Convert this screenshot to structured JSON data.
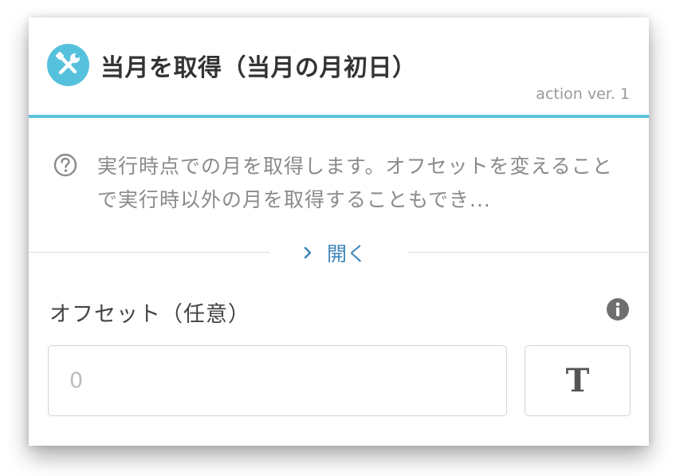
{
  "header": {
    "icon": "tools-icon",
    "title": "当月を取得（当月の月初日）",
    "version": "action ver. 1"
  },
  "description": {
    "icon": "help-circle-icon",
    "text": "実行時点での月を取得します。オフセットを変えることで実行時以外の月を取得することもでき..."
  },
  "expand": {
    "icon": "chevron-right-icon",
    "label": "開く"
  },
  "field": {
    "label": "オフセット（任意）",
    "info_icon": "info-icon",
    "placeholder": "0",
    "value": "",
    "type_button_label": "T"
  },
  "colors": {
    "accent": "#5bc2dc",
    "link": "#3f86b8"
  }
}
